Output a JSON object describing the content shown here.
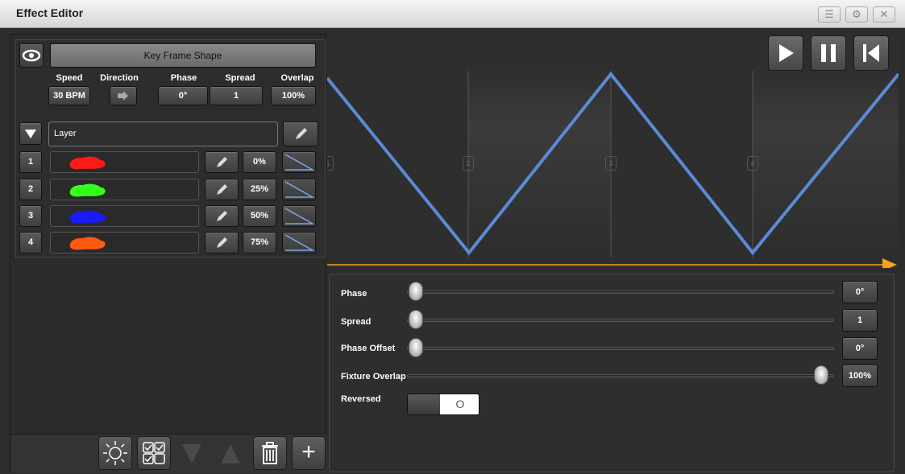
{
  "window": {
    "title": "Effect Editor",
    "controls": [
      {
        "name": "menu-icon",
        "glyph": "☰"
      },
      {
        "name": "settings-icon",
        "glyph": "⚙"
      },
      {
        "name": "close-icon",
        "glyph": "✕"
      }
    ]
  },
  "effect": {
    "key_frame_shape_label": "Key Frame Shape",
    "headers": {
      "speed": "Speed",
      "direction": "Direction",
      "phase": "Phase",
      "spread": "Spread",
      "overlap": "Overlap"
    },
    "values": {
      "speed": "30 BPM",
      "phase": "0°",
      "spread": "1",
      "overlap": "100%"
    },
    "layer_label": "Layer",
    "layers": [
      {
        "number": "1",
        "color": "#ff1a1a",
        "percent": "0%"
      },
      {
        "number": "2",
        "color": "#33ff1a",
        "percent": "25%"
      },
      {
        "number": "3",
        "color": "#1a1aff",
        "percent": "50%"
      },
      {
        "number": "4",
        "color": "#ff5a10",
        "percent": "75%"
      }
    ]
  },
  "waveform": {
    "markers": [
      "1",
      "2",
      "3",
      "4"
    ],
    "line_color": "#5b8bd6",
    "cursor_color": "#f3a21b"
  },
  "params": {
    "phase": {
      "label": "Phase",
      "value": "0°",
      "position": 0.0
    },
    "spread": {
      "label": "Spread",
      "value": "1",
      "position": 0.0
    },
    "phase_offset": {
      "label": "Phase Offset",
      "value": "0°",
      "position": 0.0
    },
    "fixture_overlap": {
      "label": "Fixture Overlap",
      "value": "100%",
      "position": 1.0
    },
    "reversed": {
      "label": "Reversed",
      "state": "off",
      "glyph": "O"
    }
  },
  "toolbar": {
    "icons": [
      "sun-icon",
      "checklist-icon",
      "move-down-icon",
      "move-up-icon",
      "delete-icon",
      "add-icon"
    ],
    "add_glyph": "+"
  }
}
